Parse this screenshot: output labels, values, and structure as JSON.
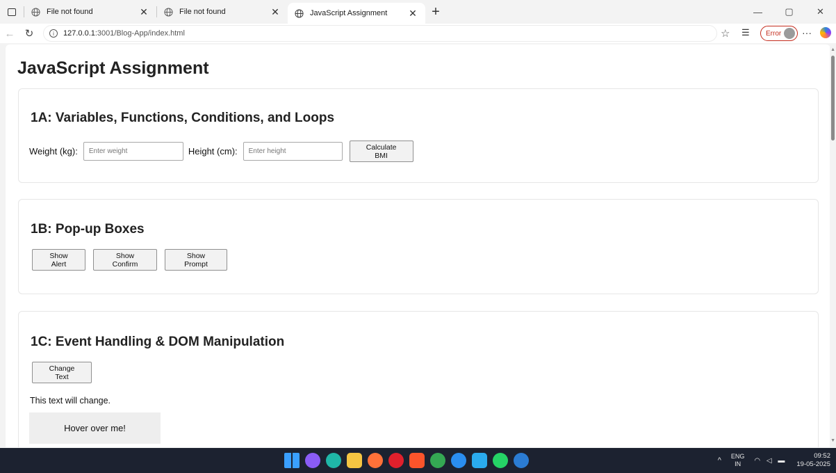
{
  "browser": {
    "tabs": [
      {
        "title": "File not found",
        "active": false
      },
      {
        "title": "File not found",
        "active": false
      },
      {
        "title": "JavaScript Assignment",
        "active": true
      }
    ],
    "url_host": "127.0.0.1",
    "url_path": ":3001/Blog-App/index.html",
    "error_label": "Error",
    "info_glyph": "i"
  },
  "page": {
    "title": "JavaScript Assignment",
    "section1": {
      "heading": "1A: Variables, Functions, Conditions, and Loops",
      "weight_label": "Weight (kg):",
      "weight_placeholder": "Enter weight",
      "height_label": "Height (cm):",
      "height_placeholder": "Enter height",
      "calc_button": "Calculate BMI"
    },
    "section2": {
      "heading": "1B: Pop-up Boxes",
      "alert_button": "Show Alert",
      "confirm_button": "Show Confirm",
      "prompt_button": "Show Prompt"
    },
    "section3": {
      "heading": "1C: Event Handling & DOM Manipulation",
      "change_button": "Change Text",
      "change_text": "This text will change.",
      "hover_text": "Hover over me!"
    }
  },
  "taskbar": {
    "lang_top": "ENG",
    "lang_bottom": "IN",
    "time": "09:52",
    "date": "19-05-2025",
    "apps": [
      {
        "icon": "windows-start-icon",
        "color": "#3aa0ff"
      },
      {
        "icon": "copilot-icon",
        "color": "#8a5cf6"
      },
      {
        "icon": "edge-icon",
        "color": "#1fb7a8"
      },
      {
        "icon": "file-explorer-icon",
        "color": "#f5c542"
      },
      {
        "icon": "firefox-icon",
        "color": "#ff7139"
      },
      {
        "icon": "opera-icon",
        "color": "#e0202c"
      },
      {
        "icon": "brave-icon",
        "color": "#fb542b"
      },
      {
        "icon": "chrome-icon",
        "color": "#34a853"
      },
      {
        "icon": "vscode-icon",
        "color": "#2a8ef0"
      },
      {
        "icon": "telegram-icon",
        "color": "#2aabee"
      },
      {
        "icon": "whatsapp-icon",
        "color": "#25d366"
      },
      {
        "icon": "word-icon",
        "color": "#2b7cd3"
      }
    ]
  }
}
